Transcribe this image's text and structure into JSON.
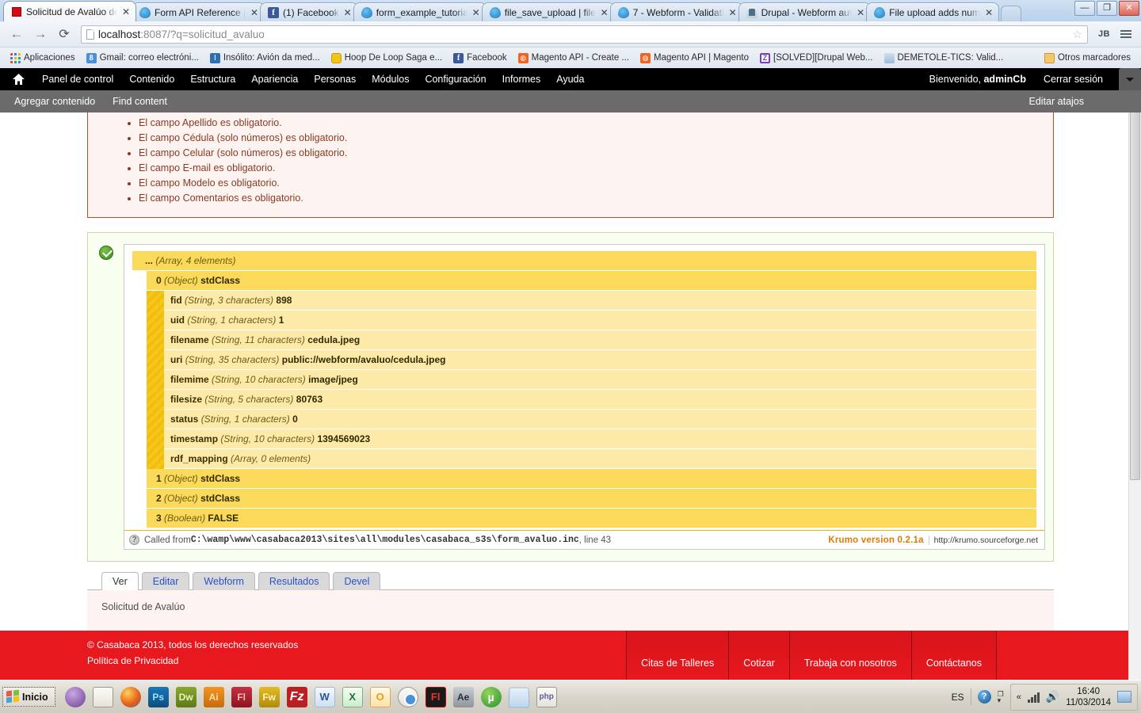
{
  "browser": {
    "tabs": [
      {
        "title": "Solicitud de Avalúo de",
        "icon": "casabaca-favicon",
        "active": true
      },
      {
        "title": "Form API Reference |",
        "icon": "drupal-favicon",
        "active": false
      },
      {
        "title": "(1) Facebook",
        "icon": "facebook-favicon",
        "active": false
      },
      {
        "title": "form_example_tutoria",
        "icon": "drupal-favicon",
        "active": false
      },
      {
        "title": "file_save_upload | file",
        "icon": "drupal-favicon",
        "active": false
      },
      {
        "title": "7 - Webform - Validati",
        "icon": "drupal-favicon",
        "active": false
      },
      {
        "title": "Drupal - Webform aut",
        "icon": "java-favicon",
        "active": false
      },
      {
        "title": "File upload adds numb",
        "icon": "drupal-favicon",
        "active": false
      }
    ],
    "tab_close_label": "✕",
    "window_controls": {
      "minimize": "—",
      "maximize": "❐",
      "close": "✕"
    },
    "nav": {
      "back": "←",
      "forward": "→",
      "reload": "⟳"
    },
    "url_prefix": "localhost",
    "url_rest": ":8087/?q=solicitud_avaluo",
    "star_icon": "☆",
    "profile_label": "JB",
    "bookmarks": [
      {
        "label": "Aplicaciones",
        "icon": "apps-grid-icon"
      },
      {
        "label": "Gmail: correo electróni...",
        "icon": "gmail-icon"
      },
      {
        "label": "Insólito: Avión da med...",
        "icon": "blue-doc-icon"
      },
      {
        "label": "Hoop De Loop Saga e...",
        "icon": "hoop-icon"
      },
      {
        "label": "Facebook",
        "icon": "facebook-icon"
      },
      {
        "label": "Magento API - Create ...",
        "icon": "magento-icon"
      },
      {
        "label": "Magento API | Magento",
        "icon": "magento-icon"
      },
      {
        "label": "[SOLVED][Drupal Web...",
        "icon": "zen-icon"
      },
      {
        "label": "DEMETOLE-TICS: Valid...",
        "icon": "demetole-icon"
      }
    ],
    "other_bookmarks": {
      "label": "Otros marcadores",
      "icon": "folder-icon"
    }
  },
  "drupal_toolbar": {
    "home_icon": "home-icon",
    "menu": [
      "Panel de control",
      "Contenido",
      "Estructura",
      "Apariencia",
      "Personas",
      "Módulos",
      "Configuración",
      "Informes",
      "Ayuda"
    ],
    "welcome_prefix": "Bienvenido, ",
    "username": "adminCb",
    "logout": "Cerrar sesión",
    "drawer": {
      "items": [
        "Agregar contenido",
        "Find content"
      ],
      "edit_shortcuts": "Editar atajos"
    }
  },
  "errors": {
    "items": [
      "El campo Apellido es obligatorio.",
      "El campo Cédula (solo números) es obligatorio.",
      "El campo Celular (solo números) es obligatorio.",
      "El campo E-mail es obligatorio.",
      "El campo Modelo es obligatorio.",
      "El campo Comentarios es obligatorio."
    ]
  },
  "krumo": {
    "root": {
      "key": "...",
      "type": "(Array, 4 elements)"
    },
    "object0": {
      "key": "0",
      "type": "(Object)",
      "class": "stdClass"
    },
    "properties": [
      {
        "name": "fid",
        "type": "(String, 3 characters)",
        "value": "898"
      },
      {
        "name": "uid",
        "type": "(String, 1 characters)",
        "value": "1"
      },
      {
        "name": "filename",
        "type": "(String, 11 characters)",
        "value": "cedula.jpeg"
      },
      {
        "name": "uri",
        "type": "(String, 35 characters)",
        "value": "public://webform/avaluo/cedula.jpeg"
      },
      {
        "name": "filemime",
        "type": "(String, 10 characters)",
        "value": "image/jpeg"
      },
      {
        "name": "filesize",
        "type": "(String, 5 characters)",
        "value": "80763"
      },
      {
        "name": "status",
        "type": "(String, 1 characters)",
        "value": "0"
      },
      {
        "name": "timestamp",
        "type": "(String, 10 characters)",
        "value": "1394569023"
      },
      {
        "name": "rdf_mapping",
        "type": "(Array, 0 elements)",
        "value": ""
      }
    ],
    "siblings": [
      {
        "key": "1",
        "type": "(Object)",
        "value": "stdClass"
      },
      {
        "key": "2",
        "type": "(Object)",
        "value": "stdClass"
      },
      {
        "key": "3",
        "type": "(Boolean)",
        "value": "FALSE"
      }
    ],
    "footer": {
      "called_from_label": "Called from ",
      "path": "C:\\wamp\\www\\casabaca2013\\sites\\all\\modules\\casabaca_s3s\\form_avaluo.inc",
      "line_label": ", line 43",
      "version": "Krumo version 0.2.1a",
      "url": "http://krumo.sourceforge.net",
      "help_icon": "question-icon"
    }
  },
  "local_tabs": [
    {
      "label": "Ver",
      "active": true
    },
    {
      "label": "Editar",
      "active": false
    },
    {
      "label": "Webform",
      "active": false
    },
    {
      "label": "Resultados",
      "active": false
    },
    {
      "label": "Devel",
      "active": false
    }
  ],
  "node": {
    "title": "Solicitud de Avalúo"
  },
  "site_footer": {
    "copyright": "© Casabaca 2013, todos los derechos reservados",
    "privacy": "Política de Privacidad",
    "nav": [
      "Citas de Talleres",
      "Cotizar",
      "Trabaja con nosotros",
      "Contáctanos"
    ]
  },
  "taskbar": {
    "start_label": "Inicio",
    "quick_launch": [
      {
        "name": "internet-explorer-icon",
        "label": ""
      },
      {
        "name": "windows-explorer-icon",
        "label": ""
      },
      {
        "name": "firefox-icon",
        "label": ""
      },
      {
        "name": "photoshop-icon",
        "label": "Ps"
      },
      {
        "name": "dreamweaver-icon",
        "label": "Dw"
      },
      {
        "name": "illustrator-icon",
        "label": "Ai"
      },
      {
        "name": "flash-icon",
        "label": "Fl"
      },
      {
        "name": "fireworks-icon",
        "label": "Fw"
      },
      {
        "name": "filezilla-icon",
        "label": "Fz"
      },
      {
        "name": "word-icon",
        "label": "W"
      },
      {
        "name": "excel-icon",
        "label": "X"
      },
      {
        "name": "outlook-icon",
        "label": "O"
      },
      {
        "name": "chrome-icon",
        "label": ""
      },
      {
        "name": "flash-builder-icon",
        "label": "Fl"
      },
      {
        "name": "after-effects-icon",
        "label": "Ae"
      },
      {
        "name": "utorrent-icon",
        "label": "µ"
      },
      {
        "name": "notepad-icon",
        "label": ""
      },
      {
        "name": "php-icon",
        "label": "php"
      }
    ],
    "tray": {
      "language": "ES",
      "help_icon": "help-icon",
      "show_hidden_icon": "chevron-up-icon",
      "network_icon": "signal-icon",
      "volume_icon": "🔊",
      "time": "16:40",
      "date": "11/03/2014",
      "show_desktop": "show-desktop-icon"
    }
  }
}
